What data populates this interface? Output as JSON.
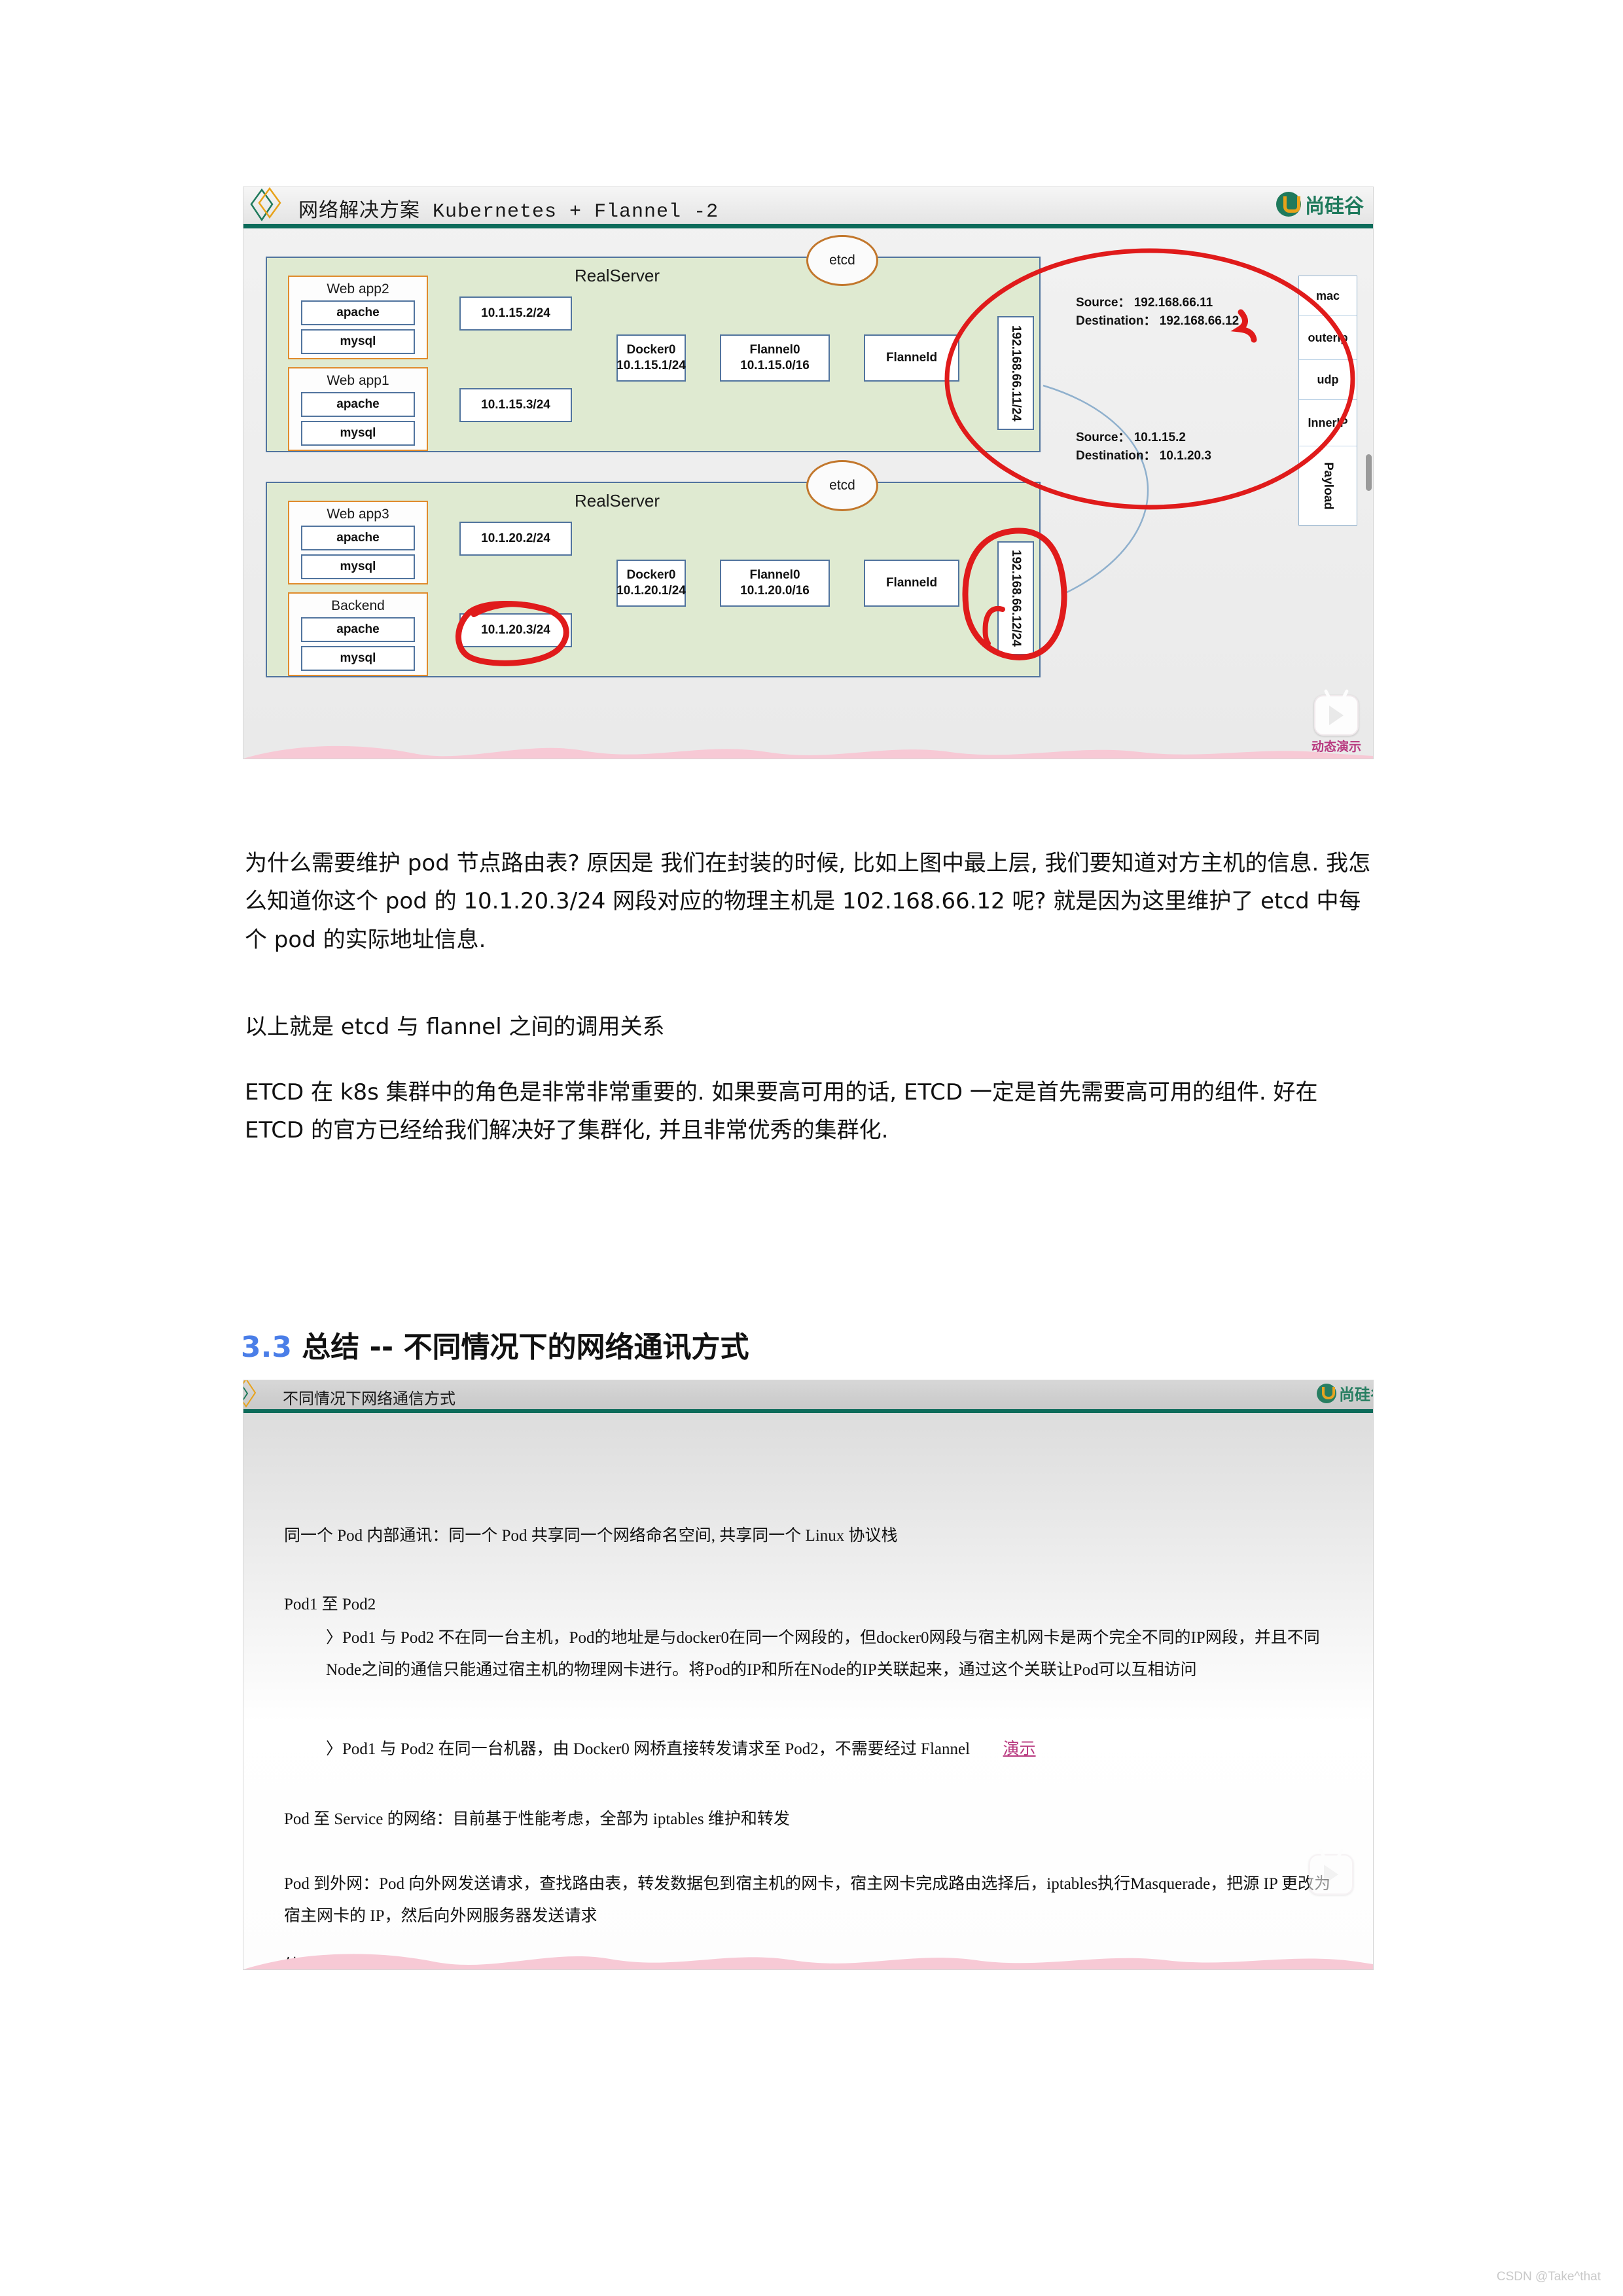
{
  "figure1": {
    "title": "网络解决方案 Kubernetes + Flannel -2",
    "brand": "尚硅谷",
    "realserver_label_top": "RealServer",
    "realserver_label_bottom": "RealServer",
    "etcd_top": "etcd",
    "etcd_bottom": "etcd",
    "pods": [
      {
        "title": "Web app2",
        "containers": [
          "apache",
          "mysql"
        ],
        "ip": "10.1.15.2/24"
      },
      {
        "title": "Web app1",
        "containers": [
          "apache",
          "mysql"
        ],
        "ip": "10.1.15.3/24"
      },
      {
        "title": "Web app3",
        "containers": [
          "apache",
          "mysql"
        ],
        "ip": "10.1.20.2/24"
      },
      {
        "title": "Backend",
        "containers": [
          "apache",
          "mysql"
        ],
        "ip": "10.1.20.3/24"
      }
    ],
    "node_top": {
      "docker0": "Docker0\n10.1.15.1/24",
      "docker0_l1": "Docker0",
      "docker0_l2": "10.1.15.1/24",
      "flannel0_l1": "Flannel0",
      "flannel0_l2": "10.1.15.0/16",
      "flanneld": "Flanneld",
      "host_nic": "192.168.66.11/24"
    },
    "node_bottom": {
      "docker0_l1": "Docker0",
      "docker0_l2": "10.1.20.1/24",
      "flannel0_l1": "Flannel0",
      "flannel0_l2": "10.1.20.0/16",
      "flanneld": "Flanneld",
      "host_nic": "192.168.66.12/24"
    },
    "outer_header": {
      "source_label": "Source：",
      "source_value": "192.168.66.11",
      "destination_label": "Destination：",
      "destination_value": "192.168.66.12"
    },
    "inner_header": {
      "source_label": "Source：",
      "source_value": "10.1.15.2",
      "destination_label": "Destination：",
      "destination_value": "10.1.20.3"
    },
    "packet_layers": [
      "mac",
      "outerIp",
      "udp",
      "InnerIP",
      "Payload"
    ],
    "demo_label": "动态演示",
    "annotation_colors": {
      "circle": "#e01b1b",
      "pod_border": "#e08b2c",
      "panel": "#dfead1",
      "node_border": "#51749e"
    }
  },
  "body": {
    "p1": " 为什么需要维护 pod 节点路由表? 原因是 我们在封装的时候, 比如上图中最上层, 我们要知道对方主机的信息. 我怎么知道你这个 pod 的 10.1.20.3/24 网段对应的物理主机是 102.168.66.12 呢?  就是因为这里维护了 etcd 中每个 pod 的实际地址信息.",
    "p2": " 以上就是 etcd 与 flannel 之间的调用关系",
    "p3": " ETCD 在 k8s 集群中的角色是非常非常重要的. 如果要高可用的话, ETCD 一定是首先需要高可用的组件. 好在 ETCD 的官方已经给我们解决好了集群化, 并且非常优秀的集群化."
  },
  "heading": {
    "number": "3.3",
    "text": "总结 -- 不同情况下的网络通讯方式"
  },
  "figure2": {
    "title": "不同情况下网络通信方式",
    "brand": "尚硅谷",
    "line_intro": "同一个 Pod 内部通讯：同一个 Pod 共享同一个网络命名空间, 共享同一个 Linux 协议栈",
    "section1_title": "Pod1 至 Pod2",
    "bullet1_marker": "〉",
    "bullet1": "Pod1 与 Pod2 不在同一台主机，Pod的地址是与docker0在同一个网段的，但docker0网段与宿主机网卡是两个完全不同的IP网段，并且不同Node之间的通信只能通过宿主机的物理网卡进行。将Pod的IP和所在Node的IP关联起来，通过这个关联让Pod可以互相访问",
    "bullet2_marker": "〉",
    "bullet2": "Pod1 与 Pod2 在同一台机器，由 Docker0 网桥直接转发请求至 Pod2，不需要经过 Flannel",
    "bullet2_link": "演示",
    "line_service": "Pod 至 Service 的网络：目前基于性能考虑，全部为 iptables 维护和转发",
    "line_outbound": "Pod 到外网：Pod 向外网发送请求，查找路由表，转发数据包到宿主机的网卡，宿主网卡完成路由选择后，iptables执行Masquerade，把源 IP 更改为宿主网卡的 IP，然后向外网服务器发送请求",
    "line_inbound": "外网访问 Pod: Service"
  },
  "watermark": "CSDN @Take^that"
}
